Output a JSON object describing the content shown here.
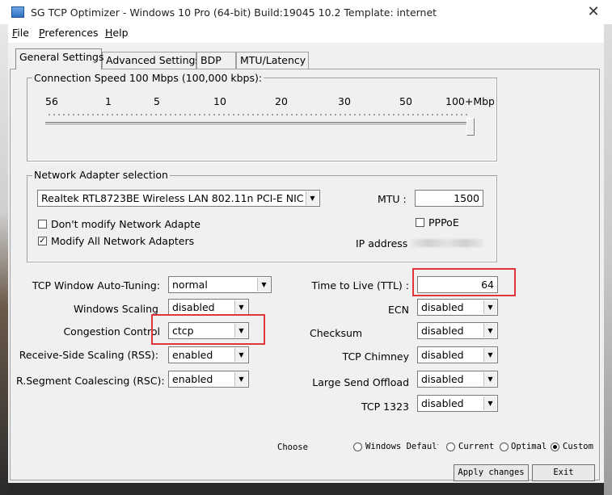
{
  "window": {
    "title": "SG TCP Optimizer - Windows 10 Pro (64-bit) Build:19045 10.2  Template: internet",
    "close_glyph": "✕"
  },
  "menu": {
    "file": {
      "u": "F",
      "rest": "ile"
    },
    "preferences": {
      "u": "P",
      "rest": "references"
    },
    "help": {
      "u": "H",
      "rest": "elp"
    }
  },
  "tabs": [
    {
      "label": "General Settings",
      "active": true
    },
    {
      "label": "Advanced Settings",
      "active": false
    },
    {
      "label": "BDP",
      "active": false
    },
    {
      "label": "MTU/Latency",
      "active": false
    }
  ],
  "connection_speed": {
    "title": "Connection Speed  100 Mbps (100,000 kbps):",
    "ticks": [
      "56",
      "1",
      "5",
      "10",
      "20",
      "30",
      "50",
      "100+Mbps"
    ],
    "level_fraction": 1.0
  },
  "adapter": {
    "title": "Network Adapter selection",
    "selected": "Realtek RTL8723BE Wireless LAN 802.11n PCI-E NIC",
    "dont_modify_label": "Don't modify Network Adapte",
    "dont_modify_checked": false,
    "modify_all_label": "Modify All Network Adapters",
    "modify_all_checked": true,
    "mtu_label": "MTU :",
    "mtu_value": "1500",
    "pppoe_label": "PPPoE",
    "pppoe_checked": false,
    "ip_label": "IP address"
  },
  "left_settings": [
    {
      "label": "TCP Window Auto-Tuning:",
      "value": "normal"
    },
    {
      "label": "Windows Scaling",
      "value": "disabled"
    },
    {
      "label": "Congestion Control",
      "value": "ctcp"
    },
    {
      "label": "Receive-Side Scaling (RSS):",
      "value": "enabled"
    },
    {
      "label": "R.Segment Coalescing (RSC):",
      "value": "enabled"
    }
  ],
  "right_settings": {
    "ttl_label": "Time to Live (TTL) :",
    "ttl_value": "64",
    "ecn_label": "ECN",
    "ecn_value": "disabled",
    "checksum_label": "Checksum",
    "checksum_value": "disabled",
    "chimney_label": "TCP Chimney",
    "chimney_value": "disabled",
    "lso_label": "Large Send Offload",
    "lso_value": "disabled",
    "tcp1323_label": "TCP 1323",
    "tcp1323_value": "disabled"
  },
  "choose": {
    "label": "Choose",
    "options": [
      "Windows Default",
      "Current",
      "Optimal",
      "Custom"
    ],
    "selected": "Custom"
  },
  "buttons": {
    "apply": "Apply changes",
    "exit": "Exit"
  },
  "colors": {
    "highlight": "#e0363a"
  }
}
